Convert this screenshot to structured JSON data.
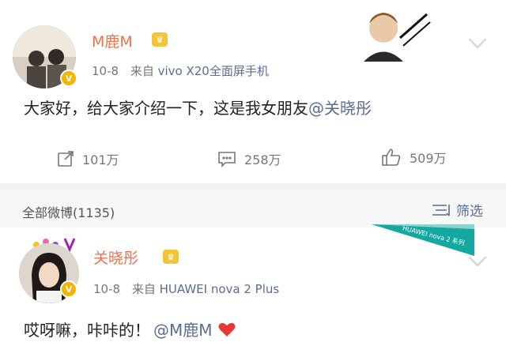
{
  "post1": {
    "author": "M鹿M",
    "date": "10-8",
    "from_label": "来自",
    "device": "vivo X20全面屏手机",
    "text": "大家好，给大家介绍一下，这是我女朋友",
    "mention": "@关晓彤",
    "stats": {
      "repost": "101万",
      "comment": "258万",
      "like": "509万"
    }
  },
  "section": {
    "title": "全部微博(1135)",
    "filter_label": "筛选"
  },
  "post2": {
    "author": "关晓彤",
    "date": "10-8",
    "from_label": "来自",
    "device": "HUAWEI nova 2 Plus",
    "text": "哎呀嘛，咔咔的！",
    "mention": "@M鹿M",
    "ribbon": "HUAWEI nova 2 系列"
  },
  "colors": {
    "accent_orange": "#eb7350",
    "link_blue": "#5a6d93",
    "heart_red": "#e53935",
    "verified_yellow": "#f6b400"
  }
}
